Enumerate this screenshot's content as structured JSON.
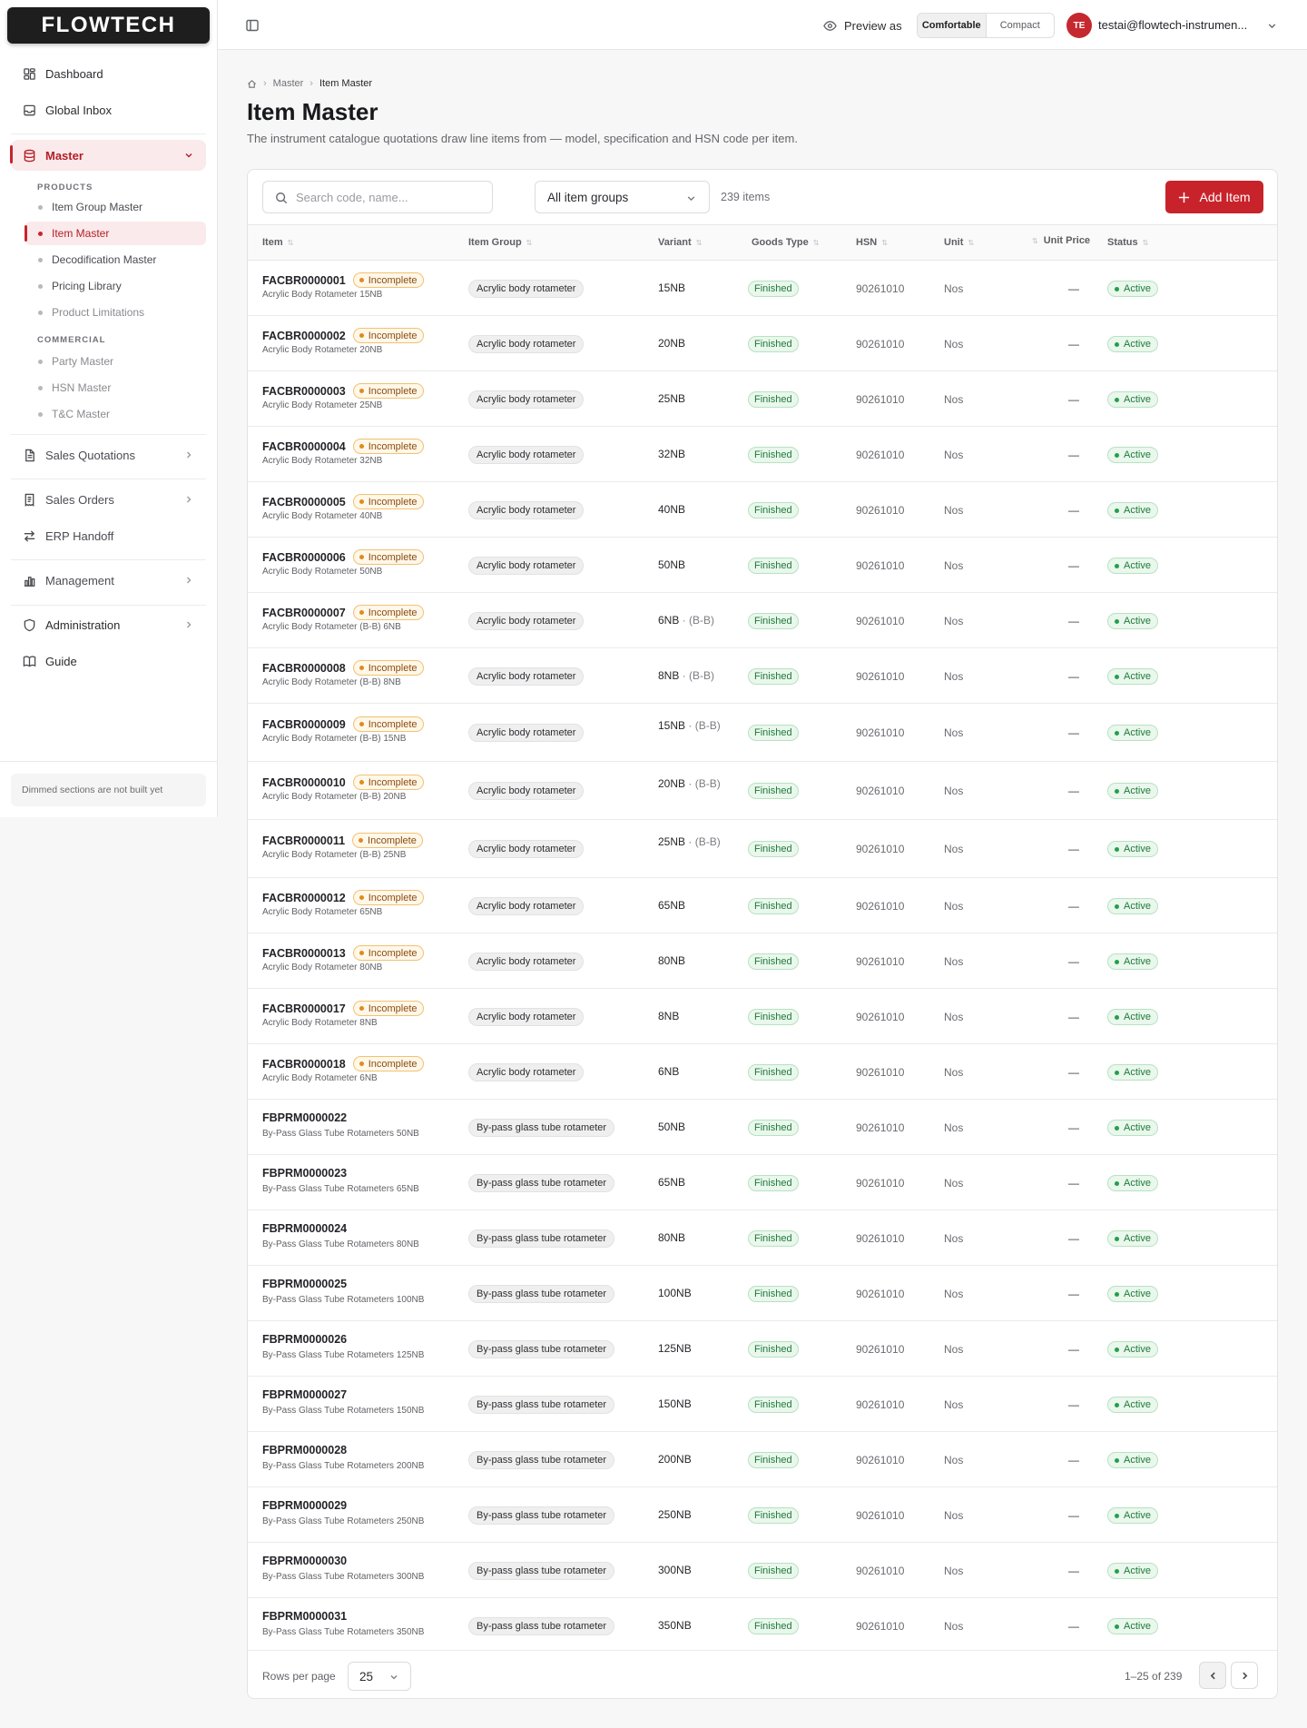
{
  "app": {
    "logo_text": "FLOWTECH",
    "brand_color": "#c8232b"
  },
  "sidebar": {
    "nav": {
      "dashboard": "Dashboard",
      "global_inbox": "Global Inbox",
      "master": "Master",
      "sales_quotations": "Sales Quotations",
      "sales_orders": "Sales Orders",
      "erp_handoff": "ERP Handoff",
      "management": "Management",
      "administration": "Administration",
      "guide": "Guide"
    },
    "sections": {
      "products": "PRODUCTS",
      "commercial": "COMMERCIAL"
    },
    "sub": {
      "item_group_master": "Item Group Master",
      "item_master": "Item Master",
      "decodification_master": "Decodification Master",
      "pricing_library": "Pricing Library",
      "product_limitations": "Product Limitations",
      "party_master": "Party Master",
      "hsn_master": "HSN Master",
      "tc_master": "T&C Master"
    },
    "footer_note": "Dimmed sections are not built yet"
  },
  "topbar": {
    "preview_as": "Preview as",
    "density": {
      "comfortable": "Comfortable",
      "compact": "Compact",
      "selected": "Comfortable"
    },
    "user_initials": "TE",
    "user_email": "testai@flowtech-instrumen..."
  },
  "breadcrumb": {
    "parent": "Master",
    "current": "Item Master"
  },
  "page": {
    "title": "Item Master",
    "subtitle": "The instrument catalogue quotations draw line items from — model, specification and HSN code per item."
  },
  "toolbar": {
    "search_placeholder": "Search code, name...",
    "group_filter": "All item groups",
    "item_count": "239 items",
    "add_label": "Add Item"
  },
  "table": {
    "columns": {
      "item": "Item",
      "item_group": "Item Group",
      "variant": "Variant",
      "goods_type": "Goods Type",
      "hsn": "HSN",
      "unit": "Unit",
      "unit_price": "Unit Price",
      "status": "Status"
    },
    "rows": [
      {
        "code": "FACBR0000001",
        "badge": "Incomplete",
        "name": "Acrylic Body Rotameter 15NB",
        "group": "Acrylic body rotameter",
        "variant": "15NB",
        "qualifier": "",
        "goods": "Finished",
        "hsn": "90261010",
        "unit": "Nos",
        "price": "—",
        "status": "Active"
      },
      {
        "code": "FACBR0000002",
        "badge": "Incomplete",
        "name": "Acrylic Body Rotameter 20NB",
        "group": "Acrylic body rotameter",
        "variant": "20NB",
        "qualifier": "",
        "goods": "Finished",
        "hsn": "90261010",
        "unit": "Nos",
        "price": "—",
        "status": "Active"
      },
      {
        "code": "FACBR0000003",
        "badge": "Incomplete",
        "name": "Acrylic Body Rotameter 25NB",
        "group": "Acrylic body rotameter",
        "variant": "25NB",
        "qualifier": "",
        "goods": "Finished",
        "hsn": "90261010",
        "unit": "Nos",
        "price": "—",
        "status": "Active"
      },
      {
        "code": "FACBR0000004",
        "badge": "Incomplete",
        "name": "Acrylic Body Rotameter 32NB",
        "group": "Acrylic body rotameter",
        "variant": "32NB",
        "qualifier": "",
        "goods": "Finished",
        "hsn": "90261010",
        "unit": "Nos",
        "price": "—",
        "status": "Active"
      },
      {
        "code": "FACBR0000005",
        "badge": "Incomplete",
        "name": "Acrylic Body Rotameter 40NB",
        "group": "Acrylic body rotameter",
        "variant": "40NB",
        "qualifier": "",
        "goods": "Finished",
        "hsn": "90261010",
        "unit": "Nos",
        "price": "—",
        "status": "Active"
      },
      {
        "code": "FACBR0000006",
        "badge": "Incomplete",
        "name": "Acrylic Body Rotameter 50NB",
        "group": "Acrylic body rotameter",
        "variant": "50NB",
        "qualifier": "",
        "goods": "Finished",
        "hsn": "90261010",
        "unit": "Nos",
        "price": "—",
        "status": "Active"
      },
      {
        "code": "FACBR0000007",
        "badge": "Incomplete",
        "name": "Acrylic Body Rotameter (B-B) 6NB",
        "group": "Acrylic body rotameter",
        "variant": "6NB",
        "qualifier": "· (B-B)",
        "goods": "Finished",
        "hsn": "90261010",
        "unit": "Nos",
        "price": "—",
        "status": "Active"
      },
      {
        "code": "FACBR0000008",
        "badge": "Incomplete",
        "name": "Acrylic Body Rotameter (B-B) 8NB",
        "group": "Acrylic body rotameter",
        "variant": "8NB",
        "qualifier": "· (B-B)",
        "goods": "Finished",
        "hsn": "90261010",
        "unit": "Nos",
        "price": "—",
        "status": "Active"
      },
      {
        "code": "FACBR0000009",
        "badge": "Incomplete",
        "name": "Acrylic Body Rotameter (B-B) 15NB",
        "group": "Acrylic body rotameter",
        "variant": "15NB",
        "qualifier": "· (B-B)",
        "goods": "Finished",
        "hsn": "90261010",
        "unit": "Nos",
        "price": "—",
        "status": "Active"
      },
      {
        "code": "FACBR0000010",
        "badge": "Incomplete",
        "name": "Acrylic Body Rotameter (B-B) 20NB",
        "group": "Acrylic body rotameter",
        "variant": "20NB",
        "qualifier": "· (B-B)",
        "goods": "Finished",
        "hsn": "90261010",
        "unit": "Nos",
        "price": "—",
        "status": "Active"
      },
      {
        "code": "FACBR0000011",
        "badge": "Incomplete",
        "name": "Acrylic Body Rotameter (B-B) 25NB",
        "group": "Acrylic body rotameter",
        "variant": "25NB",
        "qualifier": "· (B-B)",
        "goods": "Finished",
        "hsn": "90261010",
        "unit": "Nos",
        "price": "—",
        "status": "Active"
      },
      {
        "code": "FACBR0000012",
        "badge": "Incomplete",
        "name": "Acrylic Body Rotameter 65NB",
        "group": "Acrylic body rotameter",
        "variant": "65NB",
        "qualifier": "",
        "goods": "Finished",
        "hsn": "90261010",
        "unit": "Nos",
        "price": "—",
        "status": "Active"
      },
      {
        "code": "FACBR0000013",
        "badge": "Incomplete",
        "name": "Acrylic Body Rotameter 80NB",
        "group": "Acrylic body rotameter",
        "variant": "80NB",
        "qualifier": "",
        "goods": "Finished",
        "hsn": "90261010",
        "unit": "Nos",
        "price": "—",
        "status": "Active"
      },
      {
        "code": "FACBR0000017",
        "badge": "Incomplete",
        "name": "Acrylic Body Rotameter 8NB",
        "group": "Acrylic body rotameter",
        "variant": "8NB",
        "qualifier": "",
        "goods": "Finished",
        "hsn": "90261010",
        "unit": "Nos",
        "price": "—",
        "status": "Active"
      },
      {
        "code": "FACBR0000018",
        "badge": "Incomplete",
        "name": "Acrylic Body Rotameter 6NB",
        "group": "Acrylic body rotameter",
        "variant": "6NB",
        "qualifier": "",
        "goods": "Finished",
        "hsn": "90261010",
        "unit": "Nos",
        "price": "—",
        "status": "Active"
      },
      {
        "code": "FBPRM0000022",
        "badge": "",
        "name": "By-Pass Glass Tube Rotameters 50NB",
        "group": "By-pass glass tube rotameter",
        "variant": "50NB",
        "qualifier": "",
        "goods": "Finished",
        "hsn": "90261010",
        "unit": "Nos",
        "price": "—",
        "status": "Active"
      },
      {
        "code": "FBPRM0000023",
        "badge": "",
        "name": "By-Pass Glass Tube Rotameters 65NB",
        "group": "By-pass glass tube rotameter",
        "variant": "65NB",
        "qualifier": "",
        "goods": "Finished",
        "hsn": "90261010",
        "unit": "Nos",
        "price": "—",
        "status": "Active"
      },
      {
        "code": "FBPRM0000024",
        "badge": "",
        "name": "By-Pass Glass Tube Rotameters 80NB",
        "group": "By-pass glass tube rotameter",
        "variant": "80NB",
        "qualifier": "",
        "goods": "Finished",
        "hsn": "90261010",
        "unit": "Nos",
        "price": "—",
        "status": "Active"
      },
      {
        "code": "FBPRM0000025",
        "badge": "",
        "name": "By-Pass Glass Tube Rotameters 100NB",
        "group": "By-pass glass tube rotameter",
        "variant": "100NB",
        "qualifier": "",
        "goods": "Finished",
        "hsn": "90261010",
        "unit": "Nos",
        "price": "—",
        "status": "Active"
      },
      {
        "code": "FBPRM0000026",
        "badge": "",
        "name": "By-Pass Glass Tube Rotameters 125NB",
        "group": "By-pass glass tube rotameter",
        "variant": "125NB",
        "qualifier": "",
        "goods": "Finished",
        "hsn": "90261010",
        "unit": "Nos",
        "price": "—",
        "status": "Active"
      },
      {
        "code": "FBPRM0000027",
        "badge": "",
        "name": "By-Pass Glass Tube Rotameters 150NB",
        "group": "By-pass glass tube rotameter",
        "variant": "150NB",
        "qualifier": "",
        "goods": "Finished",
        "hsn": "90261010",
        "unit": "Nos",
        "price": "—",
        "status": "Active"
      },
      {
        "code": "FBPRM0000028",
        "badge": "",
        "name": "By-Pass Glass Tube Rotameters 200NB",
        "group": "By-pass glass tube rotameter",
        "variant": "200NB",
        "qualifier": "",
        "goods": "Finished",
        "hsn": "90261010",
        "unit": "Nos",
        "price": "—",
        "status": "Active"
      },
      {
        "code": "FBPRM0000029",
        "badge": "",
        "name": "By-Pass Glass Tube Rotameters 250NB",
        "group": "By-pass glass tube rotameter",
        "variant": "250NB",
        "qualifier": "",
        "goods": "Finished",
        "hsn": "90261010",
        "unit": "Nos",
        "price": "—",
        "status": "Active"
      },
      {
        "code": "FBPRM0000030",
        "badge": "",
        "name": "By-Pass Glass Tube Rotameters 300NB",
        "group": "By-pass glass tube rotameter",
        "variant": "300NB",
        "qualifier": "",
        "goods": "Finished",
        "hsn": "90261010",
        "unit": "Nos",
        "price": "—",
        "status": "Active"
      },
      {
        "code": "FBPRM0000031",
        "badge": "",
        "name": "By-Pass Glass Tube Rotameters 350NB",
        "group": "By-pass glass tube rotameter",
        "variant": "350NB",
        "qualifier": "",
        "goods": "Finished",
        "hsn": "90261010",
        "unit": "Nos",
        "price": "—",
        "status": "Active"
      }
    ]
  },
  "pagination": {
    "rows_per_page_label": "Rows per page",
    "rows_per_page": "25",
    "range": "1–25 of 239"
  }
}
